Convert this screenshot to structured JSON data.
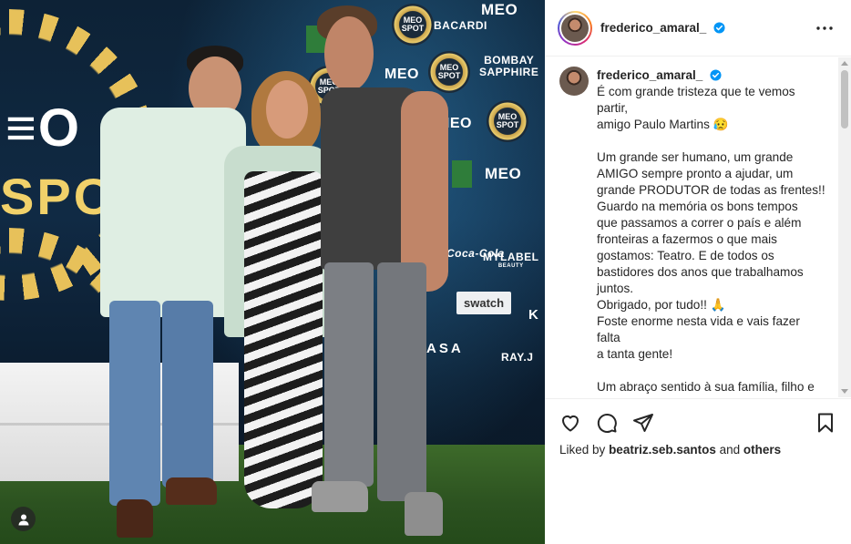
{
  "post": {
    "username": "frederico_amaral_",
    "verified": true,
    "more_label": "More options"
  },
  "photo": {
    "backdrop_brands": {
      "meo_big": "≡O",
      "spot_big": "SPOT",
      "meo_small_1": "MEO",
      "meo_small_2": "MEO",
      "meo_small_3": "MEO",
      "meo_small_4": "MEO",
      "bacardi": "BACARDI",
      "bombay_line1": "BOMBAY",
      "bombay_line2": "SAPPHIRE",
      "coca": "Coca-Cola",
      "mylabel_line1": "MYLABEL",
      "mylabel_line2": "BEAUTY",
      "swatch": "swatch",
      "casa": "ASA",
      "ray": "RAY.J",
      "meo_spot_badge": "MEO SPOT",
      "k": "K"
    },
    "tag_icon": "user-tag-icon"
  },
  "caption": {
    "username": "frederico_amaral_",
    "lines": [
      "É com grande tristeza que te vemos",
      "partir,",
      "amigo Paulo Martins 😥",
      "",
      "Um grande ser humano, um grande",
      "AMIGO sempre pronto a ajudar, um",
      "grande PRODUTOR de todas as frentes!!",
      "Guardo na memória os bons tempos",
      "que passamos a correr o país e além",
      "fronteiras a fazermos o que mais",
      "gostamos: Teatro. E de todos os",
      "bastidores dos anos que trabalhamos",
      "juntos.",
      "Obrigado, por tudo!! 🙏",
      "Foste enorme nesta vida e vais fazer",
      "falta",
      "a tanta gente!",
      "",
      "Um abraço sentido à sua família, filho e"
    ]
  },
  "actions": {
    "icons": [
      "heart-icon",
      "comment-icon",
      "share-icon",
      "bookmark-icon"
    ],
    "liked_by_prefix": "Liked by",
    "liked_by_user": "beatriz.seb.santos",
    "liked_by_and": "and",
    "liked_by_others": "others"
  },
  "colors": {
    "verified_blue": "#0095f6",
    "text": "#262626",
    "border": "#efefef"
  }
}
